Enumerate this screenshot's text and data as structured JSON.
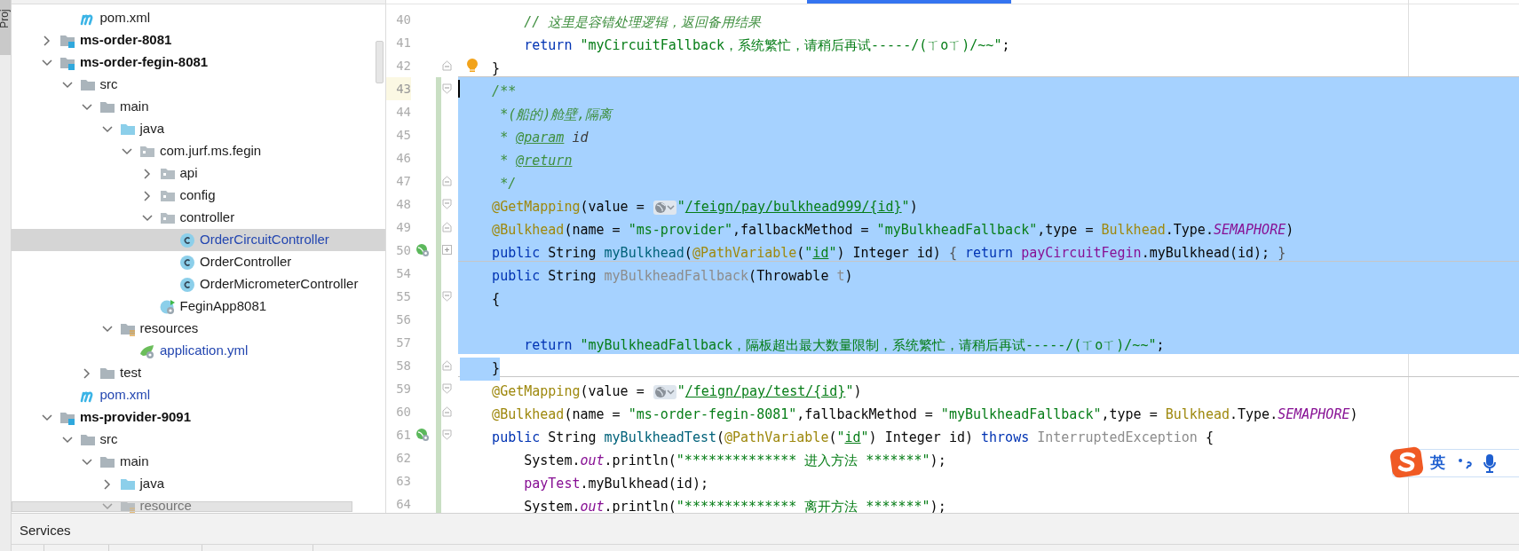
{
  "side_stripe": {
    "label": "Proj"
  },
  "project_tree": {
    "continued_items": [
      {
        "label": "pom.xml",
        "kind": "maven",
        "modified": false,
        "selected": false
      }
    ],
    "items": [
      {
        "label": "ms-order-8081",
        "kind": "module",
        "expanded": false,
        "modified": false,
        "selected": false
      },
      {
        "label": "ms-order-fegin-8081",
        "kind": "module",
        "expanded": true,
        "modified": false,
        "selected": false,
        "children": [
          {
            "label": "src",
            "kind": "folder",
            "expanded": true,
            "modified": false,
            "selected": false,
            "children": [
              {
                "label": "main",
                "kind": "folder",
                "expanded": true,
                "modified": false,
                "selected": false,
                "children": [
                  {
                    "label": "java",
                    "kind": "source",
                    "expanded": true,
                    "modified": false,
                    "selected": false,
                    "children": [
                      {
                        "label": "com.jurf.ms.fegin",
                        "kind": "package",
                        "expanded": true,
                        "modified": false,
                        "selected": false,
                        "children": [
                          {
                            "label": "api",
                            "kind": "package",
                            "expanded": false,
                            "modified": false,
                            "selected": false
                          },
                          {
                            "label": "config",
                            "kind": "package",
                            "expanded": false,
                            "modified": false,
                            "selected": false
                          },
                          {
                            "label": "controller",
                            "kind": "package",
                            "expanded": true,
                            "modified": false,
                            "selected": false,
                            "children": [
                              {
                                "label": "OrderCircuitController",
                                "kind": "class",
                                "modified": true,
                                "selected": true
                              },
                              {
                                "label": "OrderController",
                                "kind": "class",
                                "modified": false,
                                "selected": false
                              },
                              {
                                "label": "OrderMicrometerController",
                                "kind": "class",
                                "modified": false,
                                "selected": false
                              }
                            ]
                          },
                          {
                            "label": "FeginApp8081",
                            "kind": "app_class",
                            "modified": false,
                            "selected": false
                          }
                        ]
                      }
                    ]
                  },
                  {
                    "label": "resources",
                    "kind": "resources",
                    "expanded": true,
                    "modified": false,
                    "selected": false,
                    "children": [
                      {
                        "label": "application.yml",
                        "kind": "yml",
                        "modified": true,
                        "selected": false
                      }
                    ]
                  }
                ]
              },
              {
                "label": "test",
                "kind": "folder",
                "expanded": false,
                "modified": false,
                "selected": false
              }
            ]
          },
          {
            "label": "pom.xml",
            "kind": "maven",
            "modified": true,
            "selected": false
          }
        ]
      },
      {
        "label": "ms-provider-9091",
        "kind": "module",
        "expanded": true,
        "modified": false,
        "selected": false,
        "children": [
          {
            "label": "src",
            "kind": "folder",
            "expanded": true,
            "modified": false,
            "selected": false,
            "children": [
              {
                "label": "main",
                "kind": "folder",
                "expanded": true,
                "modified": false,
                "selected": false,
                "children": [
                  {
                    "label": "java",
                    "kind": "source",
                    "expanded": false,
                    "modified": false,
                    "selected": false
                  },
                  {
                    "label": "resource",
                    "kind": "resources",
                    "expanded": true,
                    "modified": false,
                    "selected": false
                  }
                ]
              }
            ]
          }
        ]
      }
    ]
  },
  "editor": {
    "lines": [
      {
        "number": "40",
        "selected": false,
        "changed": false,
        "current": false,
        "separator_below": false,
        "tokens": [
          {
            "kind": "comment",
            "text": "        // 这里是容错处理逻辑，返回备用结果"
          }
        ]
      },
      {
        "number": "41",
        "selected": false,
        "changed": false,
        "current": false,
        "separator_below": false,
        "tokens": [
          {
            "kind": "keyword",
            "text": "        return "
          },
          {
            "kind": "string",
            "text": "\"myCircuitFallback，系统繁忙，请稍后再试-----/(ㄒoㄒ)/~~\""
          },
          {
            "kind": "plain",
            "text": ";"
          }
        ]
      },
      {
        "number": "42",
        "selected": false,
        "changed": false,
        "current": false,
        "separator_below": true,
        "fold": {
          "kind": "end"
        },
        "marker": {
          "kind": "bulb"
        },
        "tokens": [
          {
            "kind": "plain",
            "text": "    }"
          }
        ]
      },
      {
        "number": "43",
        "selected": true,
        "changed": true,
        "current": true,
        "separator_below": false,
        "fold": {
          "kind": "start"
        },
        "tokens": [
          {
            "kind": "comment",
            "text": "    /**"
          }
        ]
      },
      {
        "number": "44",
        "selected": true,
        "changed": true,
        "current": false,
        "separator_below": false,
        "tokens": [
          {
            "kind": "comment",
            "text": "     *(船的)舱壁,隔离"
          }
        ]
      },
      {
        "number": "45",
        "selected": true,
        "changed": true,
        "current": false,
        "separator_below": false,
        "tokens": [
          {
            "kind": "comment",
            "text": "     * "
          },
          {
            "kind": "doc_tag",
            "text": "@param"
          },
          {
            "kind": "doc_value",
            "text": " id"
          }
        ]
      },
      {
        "number": "46",
        "selected": true,
        "changed": true,
        "current": false,
        "separator_below": false,
        "tokens": [
          {
            "kind": "comment",
            "text": "     * "
          },
          {
            "kind": "doc_tag",
            "text": "@return"
          }
        ]
      },
      {
        "number": "47",
        "selected": true,
        "changed": true,
        "current": false,
        "separator_below": false,
        "fold": {
          "kind": "end"
        },
        "tokens": [
          {
            "kind": "comment",
            "text": "     */"
          }
        ]
      },
      {
        "number": "48",
        "selected": true,
        "changed": true,
        "current": false,
        "separator_below": false,
        "fold": {
          "kind": "start"
        },
        "tokens": [
          {
            "kind": "annotation",
            "text": "    @GetMapping"
          },
          {
            "kind": "plain",
            "text": "(value = "
          },
          {
            "kind": "url_icon"
          },
          {
            "kind": "string",
            "text": "\""
          },
          {
            "kind": "link",
            "text": "/feign/pay/bulkhead999/{id}"
          },
          {
            "kind": "string",
            "text": "\""
          },
          {
            "kind": "plain",
            "text": ")"
          }
        ]
      },
      {
        "number": "49",
        "selected": true,
        "changed": true,
        "current": false,
        "separator_below": false,
        "fold": {
          "kind": "end"
        },
        "tokens": [
          {
            "kind": "annotation",
            "text": "    @Bulkhead"
          },
          {
            "kind": "plain",
            "text": "(name = "
          },
          {
            "kind": "string",
            "text": "\"ms-provider\""
          },
          {
            "kind": "plain",
            "text": ",fallbackMethod = "
          },
          {
            "kind": "string",
            "text": "\"myBulkheadFallback\""
          },
          {
            "kind": "plain",
            "text": ",type = "
          },
          {
            "kind": "annotation",
            "text": "Bulkhead"
          },
          {
            "kind": "plain",
            "text": ".Type."
          },
          {
            "kind": "static",
            "text": "SEMAPHORE"
          },
          {
            "kind": "plain",
            "text": ")"
          }
        ]
      },
      {
        "number": "50",
        "selected": true,
        "changed": true,
        "current": false,
        "separator_below": true,
        "fold": {
          "kind": "collapsed"
        },
        "marker": {
          "kind": "endpoint"
        },
        "tokens": [
          {
            "kind": "keyword",
            "text": "    public "
          },
          {
            "kind": "plain",
            "text": "String "
          },
          {
            "kind": "method",
            "text": "myBulkhead"
          },
          {
            "kind": "plain",
            "text": "("
          },
          {
            "kind": "annotation",
            "text": "@PathVariable"
          },
          {
            "kind": "plain",
            "text": "("
          },
          {
            "kind": "string",
            "text": "\""
          },
          {
            "kind": "link",
            "text": "id"
          },
          {
            "kind": "string",
            "text": "\""
          },
          {
            "kind": "plain",
            "text": ") Integer id) "
          },
          {
            "kind": "folded",
            "text": "{ "
          },
          {
            "kind": "keyword",
            "text": "return "
          },
          {
            "kind": "field",
            "text": "payCircuitFegin"
          },
          {
            "kind": "plain",
            "text": ".myBulkhead(id); "
          },
          {
            "kind": "folded",
            "text": "}"
          }
        ]
      },
      {
        "number": "54",
        "selected": true,
        "changed": true,
        "current": false,
        "separator_below": false,
        "tokens": [
          {
            "kind": "keyword",
            "text": "    public "
          },
          {
            "kind": "plain",
            "text": "String "
          },
          {
            "kind": "unused",
            "text": "myBulkheadFallback"
          },
          {
            "kind": "plain",
            "text": "(Throwable "
          },
          {
            "kind": "unused",
            "text": "t"
          },
          {
            "kind": "plain",
            "text": ")"
          }
        ]
      },
      {
        "number": "55",
        "selected": true,
        "changed": true,
        "current": false,
        "separator_below": false,
        "fold": {
          "kind": "start"
        },
        "tokens": [
          {
            "kind": "plain",
            "text": "    {"
          }
        ]
      },
      {
        "number": "56",
        "selected": true,
        "changed": true,
        "current": false,
        "separator_below": false
      },
      {
        "number": "57",
        "selected": true,
        "changed": true,
        "current": false,
        "separator_below": false,
        "tokens": [
          {
            "kind": "keyword",
            "text": "        return "
          },
          {
            "kind": "string",
            "text": "\"myBulkheadFallback，隔板超出最大数量限制，系统繁忙，请稍后再试-----/(ㄒoㄒ)/~~\""
          },
          {
            "kind": "plain",
            "text": ";"
          }
        ]
      },
      {
        "number": "58",
        "selected": false,
        "changed": true,
        "current": false,
        "separator_below": true,
        "fold": {
          "kind": "end"
        },
        "tokens": [
          {
            "kind": "plain",
            "text": "    }",
            "selected": true
          }
        ]
      },
      {
        "number": "59",
        "selected": false,
        "changed": true,
        "current": false,
        "separator_below": false,
        "fold": {
          "kind": "start"
        },
        "tokens": [
          {
            "kind": "annotation",
            "text": "    @GetMapping"
          },
          {
            "kind": "plain",
            "text": "(value = "
          },
          {
            "kind": "url_icon"
          },
          {
            "kind": "string",
            "text": "\""
          },
          {
            "kind": "link",
            "text": "/feign/pay/test/{id}"
          },
          {
            "kind": "string",
            "text": "\""
          },
          {
            "kind": "plain",
            "text": ")"
          }
        ]
      },
      {
        "number": "60",
        "selected": false,
        "changed": true,
        "current": false,
        "separator_below": false,
        "fold": {
          "kind": "end"
        },
        "tokens": [
          {
            "kind": "annotation",
            "text": "    @Bulkhead"
          },
          {
            "kind": "plain",
            "text": "(name = "
          },
          {
            "kind": "string",
            "text": "\"ms-order-fegin-8081\""
          },
          {
            "kind": "plain",
            "text": ",fallbackMethod = "
          },
          {
            "kind": "string",
            "text": "\"myBulkheadFallback\""
          },
          {
            "kind": "plain",
            "text": ",type = "
          },
          {
            "kind": "annotation",
            "text": "Bulkhead"
          },
          {
            "kind": "plain",
            "text": ".Type."
          },
          {
            "kind": "static",
            "text": "SEMAPHORE"
          },
          {
            "kind": "plain",
            "text": ")"
          }
        ]
      },
      {
        "number": "61",
        "selected": false,
        "changed": true,
        "current": false,
        "separator_below": false,
        "fold": {
          "kind": "start"
        },
        "marker": {
          "kind": "endpoint"
        },
        "tokens": [
          {
            "kind": "keyword",
            "text": "    public "
          },
          {
            "kind": "plain",
            "text": "String "
          },
          {
            "kind": "method",
            "text": "myBulkheadTest"
          },
          {
            "kind": "plain",
            "text": "("
          },
          {
            "kind": "annotation",
            "text": "@PathVariable"
          },
          {
            "kind": "plain",
            "text": "("
          },
          {
            "kind": "string",
            "text": "\""
          },
          {
            "kind": "link",
            "text": "id"
          },
          {
            "kind": "string",
            "text": "\""
          },
          {
            "kind": "plain",
            "text": ") Integer id) "
          },
          {
            "kind": "keyword",
            "text": "throws "
          },
          {
            "kind": "unused",
            "text": "InterruptedException"
          },
          {
            "kind": "plain",
            "text": " {"
          }
        ]
      },
      {
        "number": "62",
        "selected": false,
        "changed": true,
        "current": false,
        "separator_below": false,
        "tokens": [
          {
            "kind": "plain",
            "text": "        System."
          },
          {
            "kind": "static",
            "text": "out"
          },
          {
            "kind": "plain",
            "text": ".println("
          },
          {
            "kind": "string",
            "text": "\"************** 进入方法 *******\""
          },
          {
            "kind": "plain",
            "text": ");"
          }
        ]
      },
      {
        "number": "63",
        "selected": false,
        "changed": true,
        "current": false,
        "separator_below": false,
        "tokens": [
          {
            "kind": "field",
            "text": "        payTest"
          },
          {
            "kind": "plain",
            "text": ".myBulkhead(id);"
          }
        ]
      },
      {
        "number": "64",
        "selected": false,
        "changed": true,
        "current": false,
        "separator_below": false,
        "tokens": [
          {
            "kind": "plain",
            "text": "        System."
          },
          {
            "kind": "static",
            "text": "out"
          },
          {
            "kind": "plain",
            "text": ".println("
          },
          {
            "kind": "string",
            "text": "\"************** 离开方法 *******\""
          },
          {
            "kind": "plain",
            "text": ");"
          }
        ]
      }
    ]
  },
  "ime_toolbar": {
    "mode": "英"
  },
  "bottom_panel": {
    "title": "Services"
  }
}
